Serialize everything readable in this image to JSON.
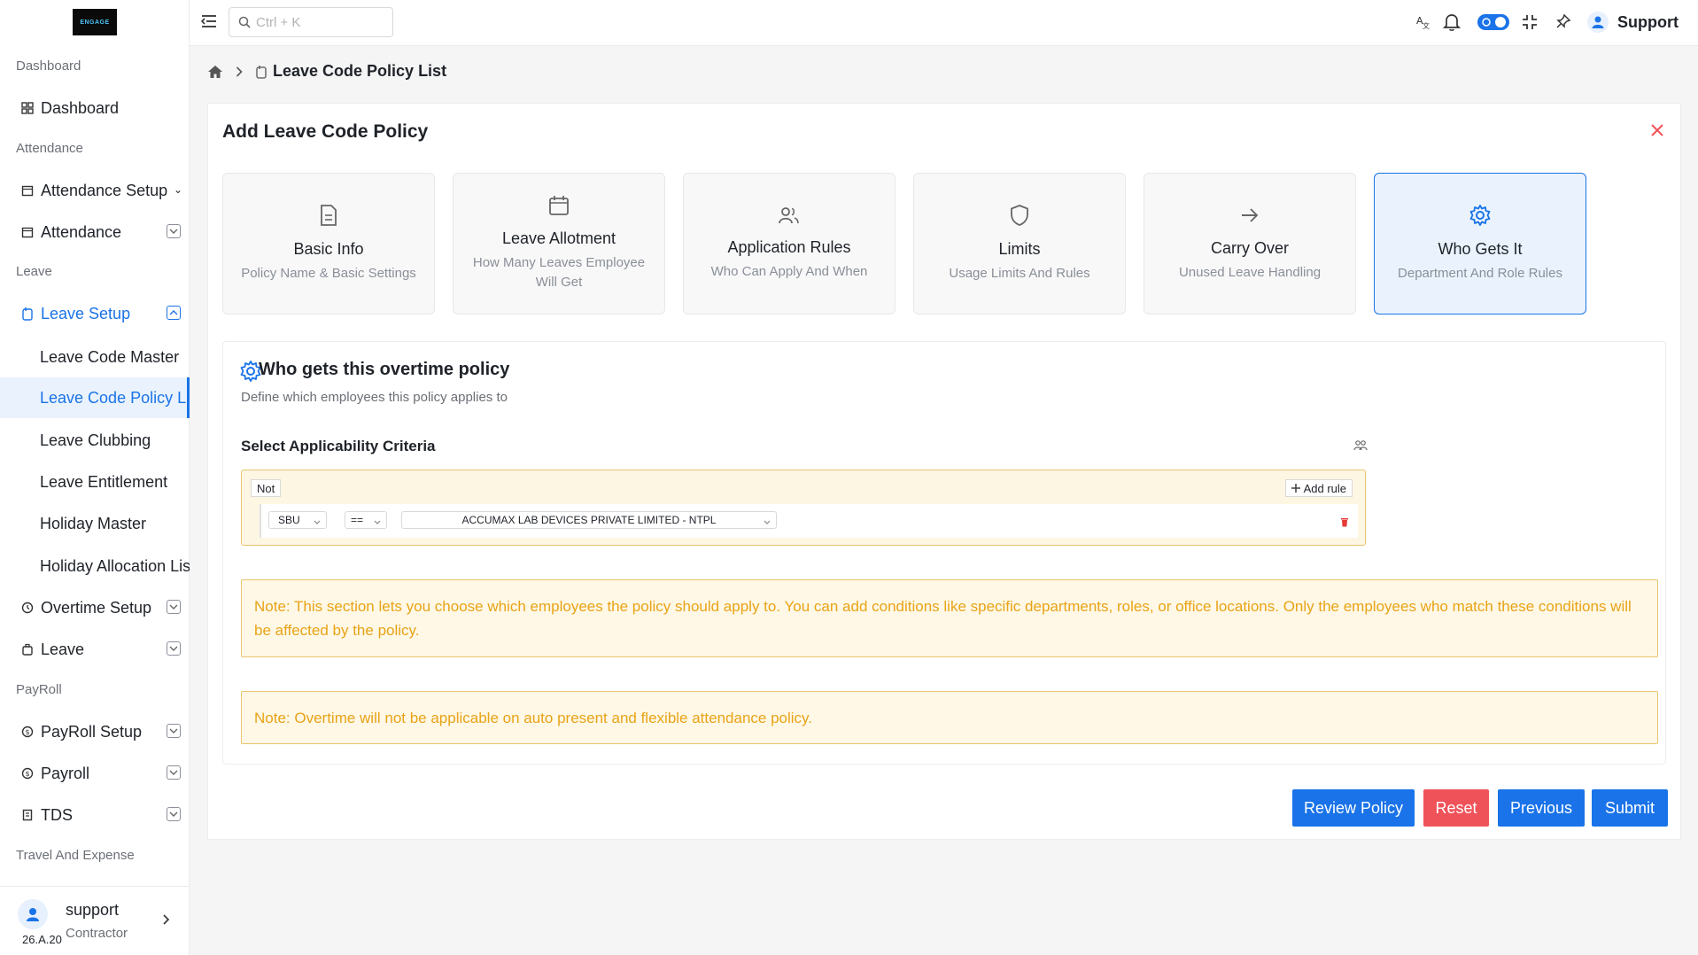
{
  "logo": {
    "text": "ENGAGE"
  },
  "sidebar": {
    "sections": {
      "dashboard": "Dashboard",
      "attendance": "Attendance",
      "leave": "Leave",
      "payroll": "PayRoll",
      "travel": "Travel And Expense"
    },
    "items": {
      "dashboard": "Dashboard",
      "attendance_setup": "Attendance Setup",
      "attendance": "Attendance",
      "leave_setup": "Leave Setup",
      "overtime_setup": "Overtime Setup",
      "leave": "Leave",
      "payroll_setup": "PayRoll Setup",
      "payroll": "Payroll",
      "tds": "TDS"
    },
    "sub_items": [
      "Leave Code Master",
      "Leave Code Policy List",
      "Leave Clubbing",
      "Leave Entitlement",
      "Holiday Master",
      "Holiday Allocation List"
    ],
    "user": {
      "name": "support",
      "role": "Contractor",
      "version": "26.A.20"
    }
  },
  "topbar": {
    "search_placeholder": "Ctrl + K",
    "user_label": "Support"
  },
  "breadcrumb": {
    "current": "Leave Code Policy List"
  },
  "card": {
    "title": "Add Leave Code Policy"
  },
  "steps": [
    {
      "title": "Basic Info",
      "subtitle": "Policy Name & Basic Settings"
    },
    {
      "title": "Leave Allotment",
      "subtitle": "How Many Leaves Employee Will Get"
    },
    {
      "title": "Application Rules",
      "subtitle": "Who Can Apply And When"
    },
    {
      "title": "Limits",
      "subtitle": "Usage Limits And Rules"
    },
    {
      "title": "Carry Over",
      "subtitle": "Unused Leave Handling"
    },
    {
      "title": "Who Gets It",
      "subtitle": "Department And Role Rules"
    }
  ],
  "section": {
    "title": "Who gets this overtime policy",
    "subtitle": "Define which employees this policy applies to",
    "criteria_label": "Select Applicability Criteria"
  },
  "query_builder": {
    "not_label": "Not",
    "add_rule_label": "Add rule",
    "rule": {
      "field": "SBU",
      "operator": "==",
      "value": "ACCUMAX LAB DEVICES PRIVATE LIMITED - NTPL"
    }
  },
  "notes": {
    "applicability": "Note: This section lets you choose which employees the policy should apply to. You can add conditions like specific departments, roles, or office locations. Only the employees who match these conditions will be affected by the policy.",
    "overtime": "Note: Overtime will not be applicable on auto present and flexible attendance policy."
  },
  "buttons": {
    "review": "Review Policy",
    "reset": "Reset",
    "previous": "Previous",
    "submit": "Submit"
  },
  "colors": {
    "primary": "#1a73e8",
    "danger": "#f0525a",
    "warning_text": "#e8a317",
    "warning_bg": "#fff8e6"
  }
}
